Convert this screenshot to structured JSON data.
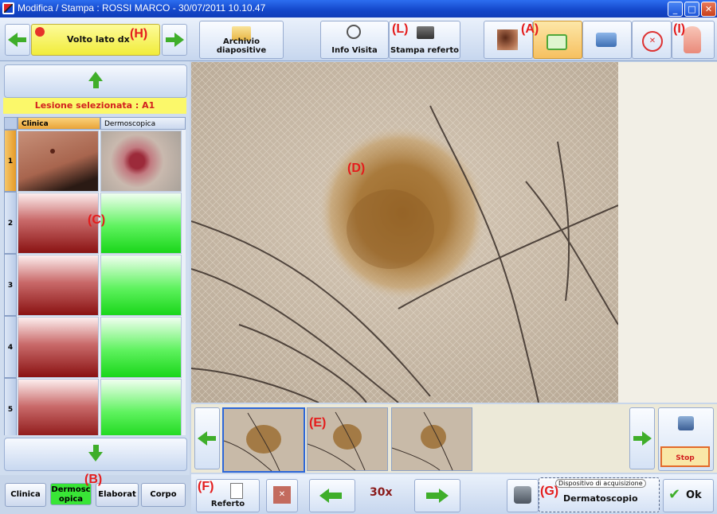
{
  "window": {
    "title": "Modifica / Stampa : ROSSI MARCO - 30/07/2011 10.10.47"
  },
  "toolbar": {
    "side_label": "Volto lato dx",
    "archive_label": "Archivio diapositive",
    "info_label": "Info Visita",
    "print_label": "Stampa referto"
  },
  "left": {
    "selected_lesion": "Lesione selezionata : A1",
    "columns": [
      "Clinica",
      "Dermoscopica"
    ],
    "rows": [
      "1",
      "2",
      "3",
      "4",
      "5"
    ]
  },
  "category_tabs": [
    "Clinica",
    "Dermosc opica",
    "Elaborat",
    "Corpo"
  ],
  "bottom": {
    "report_label": "Referto",
    "zoom": "30x",
    "device_caption": "Dispositivo di acquisizione",
    "device_name": "Dermatoscopio",
    "ok_label": "Ok",
    "stop_label": "Stop capture"
  },
  "annotations": {
    "A": "(A)",
    "B": "(B)",
    "C": "(C)",
    "D": "(D)",
    "E": "(E)",
    "F": "(F)",
    "G": "(G)",
    "H": "(H)",
    "I": "(I)",
    "L": "(L)"
  },
  "colors": {
    "active_green": "#39e536",
    "label_red": "#e41c1c",
    "banner_yellow": "#fbf86a"
  }
}
